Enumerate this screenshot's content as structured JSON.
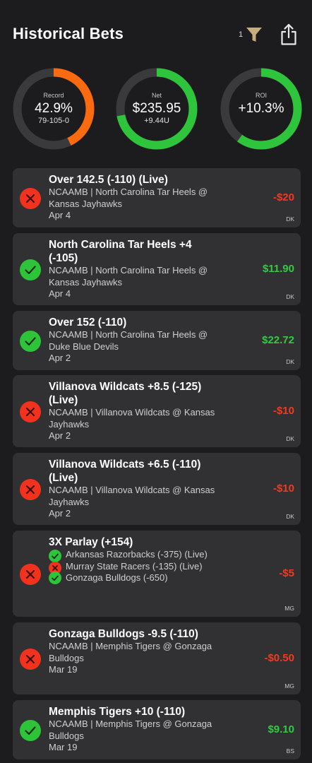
{
  "header": {
    "title": "Historical Bets",
    "filter_count": "1"
  },
  "stats": [
    {
      "label": "Record",
      "value": "42.9%",
      "sub": "79-105-0",
      "fraction": 0.429,
      "color": "#fb6a0f"
    },
    {
      "label": "Net",
      "value": "$235.95",
      "sub": "+9.44U",
      "fraction": 0.72,
      "color": "#2ec43b"
    },
    {
      "label": "ROI",
      "value": "+10.3%",
      "sub": "",
      "fraction": 0.6,
      "color": "#2ec43b"
    }
  ],
  "bets": [
    {
      "result": "loss",
      "title": "Over 142.5 (-110) (Live)",
      "game": "NCAAMB | North Carolina Tar Heels @ Kansas Jayhawks",
      "date": "Apr 4",
      "amount": "-$20",
      "book": "DK"
    },
    {
      "result": "win",
      "title": "North Carolina Tar Heels +4 (-105)",
      "game": "NCAAMB | North Carolina Tar Heels @ Kansas Jayhawks",
      "date": "Apr 4",
      "amount": "$11.90",
      "book": "DK"
    },
    {
      "result": "win",
      "title": "Over 152 (-110)",
      "game": "NCAAMB | North Carolina Tar Heels @ Duke Blue Devils",
      "date": "Apr 2",
      "amount": "$22.72",
      "book": "DK"
    },
    {
      "result": "loss",
      "title": "Villanova Wildcats +8.5 (-125) (Live)",
      "game": "NCAAMB | Villanova Wildcats @ Kansas Jayhawks",
      "date": "Apr 2",
      "amount": "-$10",
      "book": "DK"
    },
    {
      "result": "loss",
      "title": "Villanova Wildcats +6.5 (-110) (Live)",
      "game": "NCAAMB | Villanova Wildcats @ Kansas Jayhawks",
      "date": "Apr 2",
      "amount": "-$10",
      "book": "DK"
    },
    {
      "result": "loss",
      "title": "3X Parlay (+154)",
      "legs": [
        {
          "result": "win",
          "text": "Arkansas Razorbacks (-375) (Live)"
        },
        {
          "result": "loss",
          "text": "Murray State Racers (-135) (Live)"
        },
        {
          "result": "win",
          "text": "Gonzaga Bulldogs (-650)"
        }
      ],
      "amount": "-$5",
      "book": "MG"
    },
    {
      "result": "loss",
      "title": "Gonzaga Bulldogs -9.5 (-110)",
      "game": "NCAAMB | Memphis Tigers @ Gonzaga Bulldogs",
      "date": "Mar 19",
      "amount": "-$0.50",
      "book": "MG"
    },
    {
      "result": "win",
      "title": "Memphis Tigers +10 (-110)",
      "game": "NCAAMB | Memphis Tigers @ Gonzaga Bulldogs",
      "date": "Mar 19",
      "amount": "$9.10",
      "book": "BS"
    }
  ]
}
